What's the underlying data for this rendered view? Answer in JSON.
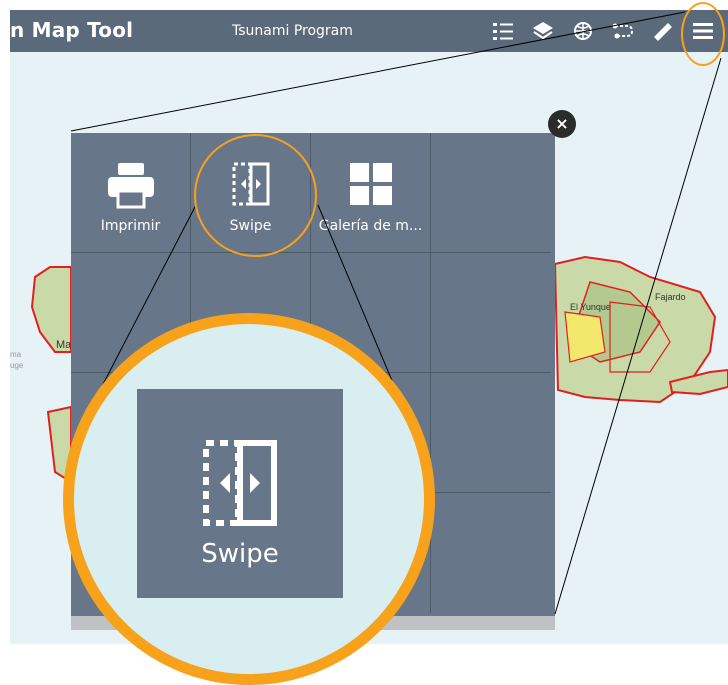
{
  "header": {
    "app_title": "n Map Tool",
    "subtitle": "Tsunami Program",
    "tools": [
      {
        "icon": "legend-icon"
      },
      {
        "icon": "layers-icon"
      },
      {
        "icon": "basemap-globe-icon"
      },
      {
        "icon": "directions-icon"
      },
      {
        "icon": "measure-ruler-icon"
      },
      {
        "icon": "menu-icon"
      }
    ]
  },
  "panel": {
    "close_label": "×",
    "items": [
      {
        "label": "Imprimir",
        "icon": "printer-icon"
      },
      {
        "label": "Swipe",
        "icon": "swipe-icon"
      },
      {
        "label": "Galería de m...",
        "icon": "gallery-grid-icon"
      }
    ]
  },
  "zoom": {
    "label": "Swipe",
    "icon": "swipe-icon"
  },
  "map": {
    "labels": [
      "El Yunque",
      "Fajardo",
      "Ma"
    ]
  },
  "colors": {
    "header": "#5a6a7b",
    "panel": "#677789",
    "highlight": "#f7a21a",
    "sea": "#e6f2f5",
    "border": "#e02020"
  }
}
